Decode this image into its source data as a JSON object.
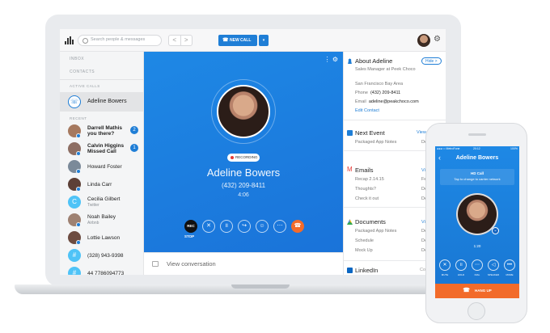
{
  "topbar": {
    "search_placeholder": "Search people & messages",
    "back_arrow": "<",
    "forward_arrow": ">",
    "new_call_label": "NEW CALL",
    "new_call_dropdown": "▾"
  },
  "sidebar": {
    "inbox_label": "INBOX",
    "contacts_label": "CONTACTS",
    "active_calls_label": "ACTIVE CALLS",
    "active_call_name": "Adeline Bowers",
    "recent_label": "RECENT",
    "recent": [
      {
        "name": "Darrell Mathis",
        "sub": "you there?",
        "badge": "2",
        "color": "#a6795f"
      },
      {
        "name": "Calvin Higgins",
        "sub": "Missed Call",
        "badge": "1",
        "color": "#8d6e63"
      },
      {
        "name": "Howard Foster",
        "sub": "",
        "badge": "",
        "color": "#7b8a99"
      },
      {
        "name": "Linda Carr",
        "sub": "",
        "badge": "",
        "color": "#5d4037"
      },
      {
        "name": "Cecilia Gilbert",
        "sub": "Twitter",
        "badge": "",
        "color": "#4fc3f7",
        "initial": "C"
      },
      {
        "name": "Noah Bailey",
        "sub": "Airbnb",
        "badge": "",
        "color": "#9e8172"
      },
      {
        "name": "Lottie Lawson",
        "sub": "",
        "badge": "",
        "color": "#6d4c41"
      },
      {
        "name": "(328) 943-9398",
        "sub": "",
        "badge": "",
        "color": "#4fc3f7",
        "initial": "#"
      },
      {
        "name": "44 7786094773",
        "sub": "",
        "badge": "",
        "color": "#4fc3f7",
        "initial": "#"
      }
    ]
  },
  "call": {
    "recording_label": "RECORDING",
    "name": "Adeline Bowers",
    "phone": "(432) 209-8411",
    "timer": "4:06",
    "rec_label": "REC",
    "stop_label": "STOP",
    "view_conversation": "View conversation"
  },
  "info": {
    "about_title": "About Adeline",
    "hide_label": "Hide >",
    "job": "Sales Manager at Peek Choco",
    "location": "San Francisco Bay Area",
    "phone_label": "Phone",
    "phone_value": "(432) 209-8411",
    "email_label": "Email",
    "email_value": "adeline@peakchoco.com",
    "edit_contact": "Edit Contact",
    "next_event_title": "Next Event",
    "view_calendar": "View Calend",
    "event_name": "Packaged App Notes",
    "event_date": "Dec",
    "emails_title": "Emails",
    "emails_view": "View",
    "emails": [
      {
        "subject": "Recap 2.14.15",
        "date": "Feb"
      },
      {
        "subject": "Thoughts?",
        "date": "Dec"
      },
      {
        "subject": "Check it out",
        "date": "Dec"
      }
    ],
    "documents_title": "Documents",
    "documents_view": "View",
    "documents": [
      {
        "name": "Packaged App Notes",
        "date": "Dec"
      },
      {
        "name": "Schedule",
        "date": "Dec"
      },
      {
        "name": "Mock Up",
        "date": "Dec"
      }
    ],
    "linkedin_title": "LinkedIn",
    "linkedin_link": "Connec"
  },
  "phone": {
    "carrier": "●●●○○ MetroFone",
    "time": "20:12",
    "battery": "100%",
    "title": "Adeline Bowers",
    "hd_title": "HD Call",
    "hd_sub": "Tap to change to carrier network",
    "timer": "1:20",
    "buttons": [
      "MUTE",
      "HOLD",
      "DIAL",
      "SPEAKER",
      "MORE"
    ],
    "hang_up": "HANG UP"
  },
  "colors": {
    "accent": "#1f7ed6",
    "call_blue": "#1e88e5",
    "hangup_orange": "#f26b2a"
  }
}
